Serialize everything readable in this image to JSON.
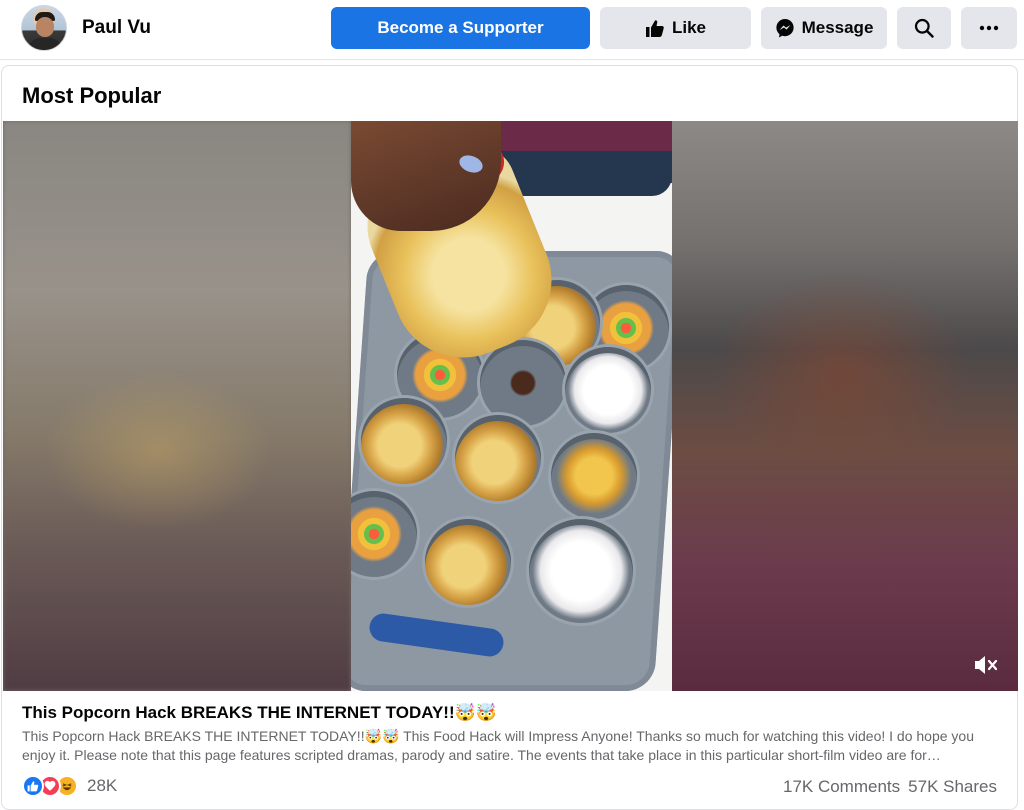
{
  "header": {
    "profile_name": "Paul Vu",
    "supporter_label": "Become a Supporter",
    "like_label": "Like",
    "message_label": "Message"
  },
  "section": {
    "title": "Most Popular"
  },
  "post": {
    "title": "This Popcorn Hack BREAKS THE INTERNET TODAY!!🤯🤯",
    "description": "This Popcorn Hack BREAKS THE INTERNET TODAY!!🤯🤯 This Food Hack will Impress Anyone! Thanks so much for watching this video! I do hope you enjoy it. Please note that this page features scripted dramas, parody and satire. The events that take place in this particular short-film video are for…",
    "reaction_count": "28K",
    "comments": "17K Comments",
    "shares": "57K Shares",
    "reactions": [
      "like-icon",
      "love-icon",
      "haha-icon"
    ],
    "video_muted": true
  },
  "colors": {
    "primary": "#1b74e4",
    "secondary_button": "#e4e6eb",
    "muted_text": "#65676b"
  }
}
